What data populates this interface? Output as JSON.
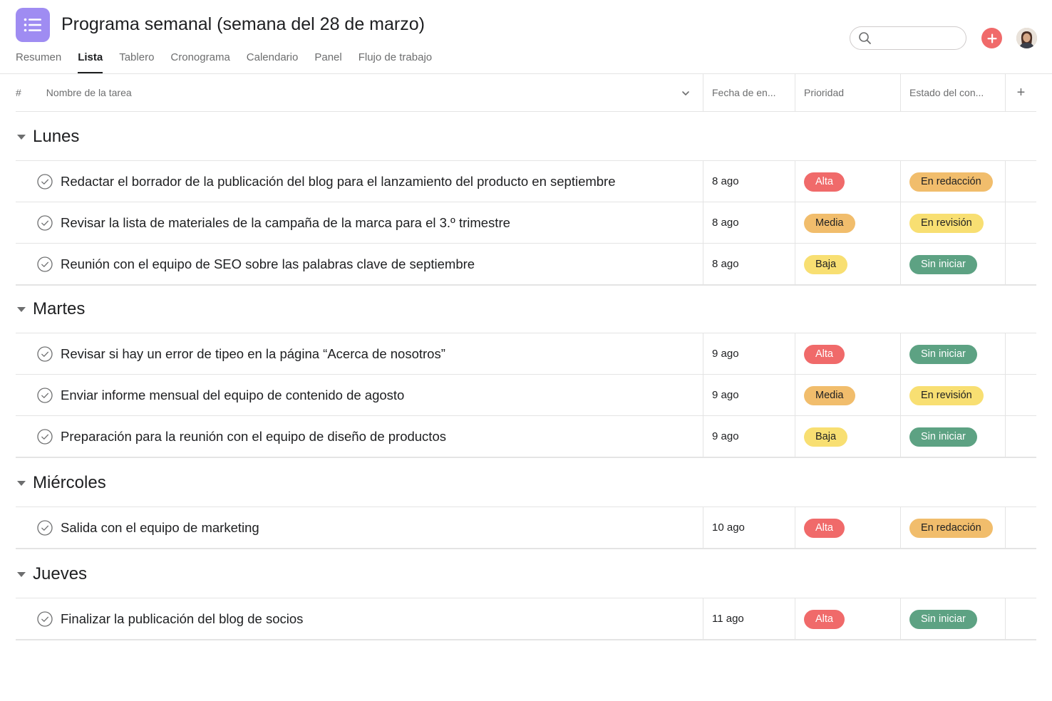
{
  "header": {
    "title": "Programa semanal (semana del 28 de marzo)",
    "tabs": [
      "Resumen",
      "Lista",
      "Tablero",
      "Cronograma",
      "Calendario",
      "Panel",
      "Flujo de trabajo"
    ],
    "active_tab": "Lista"
  },
  "columns": {
    "number": "#",
    "name": "Nombre de la tarea",
    "date": "Fecha de en...",
    "priority": "Prioridad",
    "status": "Estado del con...",
    "add": "+"
  },
  "colors": {
    "alta": "#f06a6a",
    "media": "#f1bd6c",
    "baja": "#f8df72",
    "en_redaccion": "#f1bd6c",
    "en_revision": "#f8df72",
    "sin_iniciar": "#5da283"
  },
  "sections": [
    {
      "title": "Lunes",
      "tasks": [
        {
          "name": "Redactar el borrador de la publicación del blog para el lanzamiento del producto en septiembre",
          "date": "8 ago",
          "priority": "Alta",
          "status": "En redacción"
        },
        {
          "name": "Revisar la lista de materiales de la campaña de la marca para el 3.º trimestre",
          "date": "8 ago",
          "priority": "Media",
          "status": "En revisión"
        },
        {
          "name": "Reunión con el equipo de SEO sobre las palabras clave de septiembre",
          "date": "8 ago",
          "priority": "Baja",
          "status": "Sin iniciar"
        }
      ]
    },
    {
      "title": "Martes",
      "tasks": [
        {
          "name": "Revisar si hay un error de tipeo en la página “Acerca de nosotros”",
          "date": "9 ago",
          "priority": "Alta",
          "status": "Sin iniciar"
        },
        {
          "name": "Enviar informe mensual del equipo de contenido de agosto",
          "date": "9 ago",
          "priority": "Media",
          "status": "En revisión"
        },
        {
          "name": "Preparación para la reunión con el equipo de diseño de productos",
          "date": "9 ago",
          "priority": "Baja",
          "status": "Sin iniciar"
        }
      ]
    },
    {
      "title": "Miércoles",
      "tasks": [
        {
          "name": "Salida con el equipo de marketing",
          "date": "10 ago",
          "priority": "Alta",
          "status": "En redacción"
        }
      ]
    },
    {
      "title": "Jueves",
      "tasks": [
        {
          "name": "Finalizar la publicación del blog de socios",
          "date": "11 ago",
          "priority": "Alta",
          "status": "Sin iniciar"
        }
      ]
    }
  ]
}
